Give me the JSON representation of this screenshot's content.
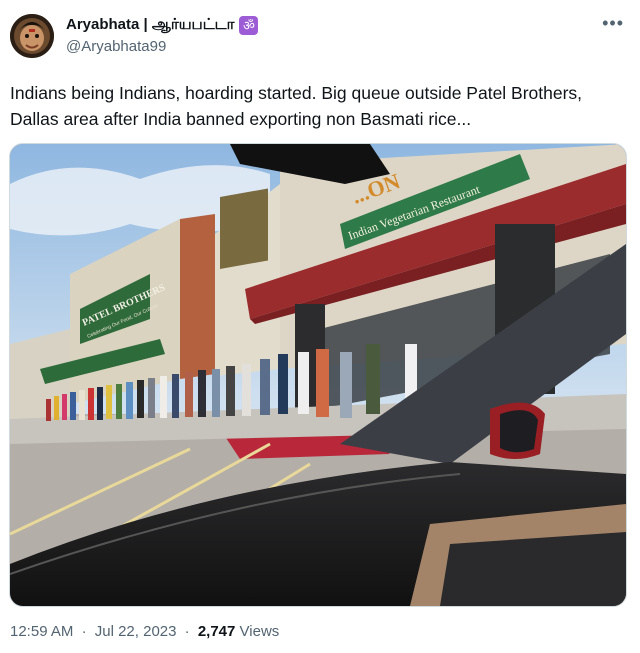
{
  "author": {
    "display_name": "Aryabhata | ஆர்யபட்டா",
    "badge": "ॐ",
    "handle": "@Aryabhata99"
  },
  "menu_icon": "more-dots-icon",
  "tweet": {
    "text": "Indians being Indians, hoarding started.  Big queue outside Patel Brothers, Dallas area after India banned exporting non Basmati rice..."
  },
  "photo": {
    "store_sign": "PATEL BROTHERS",
    "store_tagline": "Celebrating Our Food, Our Culture",
    "restaurant_name_fragment": "...ON",
    "restaurant_sign": "Indian Vegetarian Restaurant"
  },
  "meta": {
    "time": "12:59 AM",
    "date": "Jul 22, 2023",
    "dot": "·",
    "views_count": "2,747",
    "views_label": "Views"
  },
  "colors": {
    "text": "#0f1419",
    "secondary": "#536471",
    "badge": "#9b5cd6"
  }
}
